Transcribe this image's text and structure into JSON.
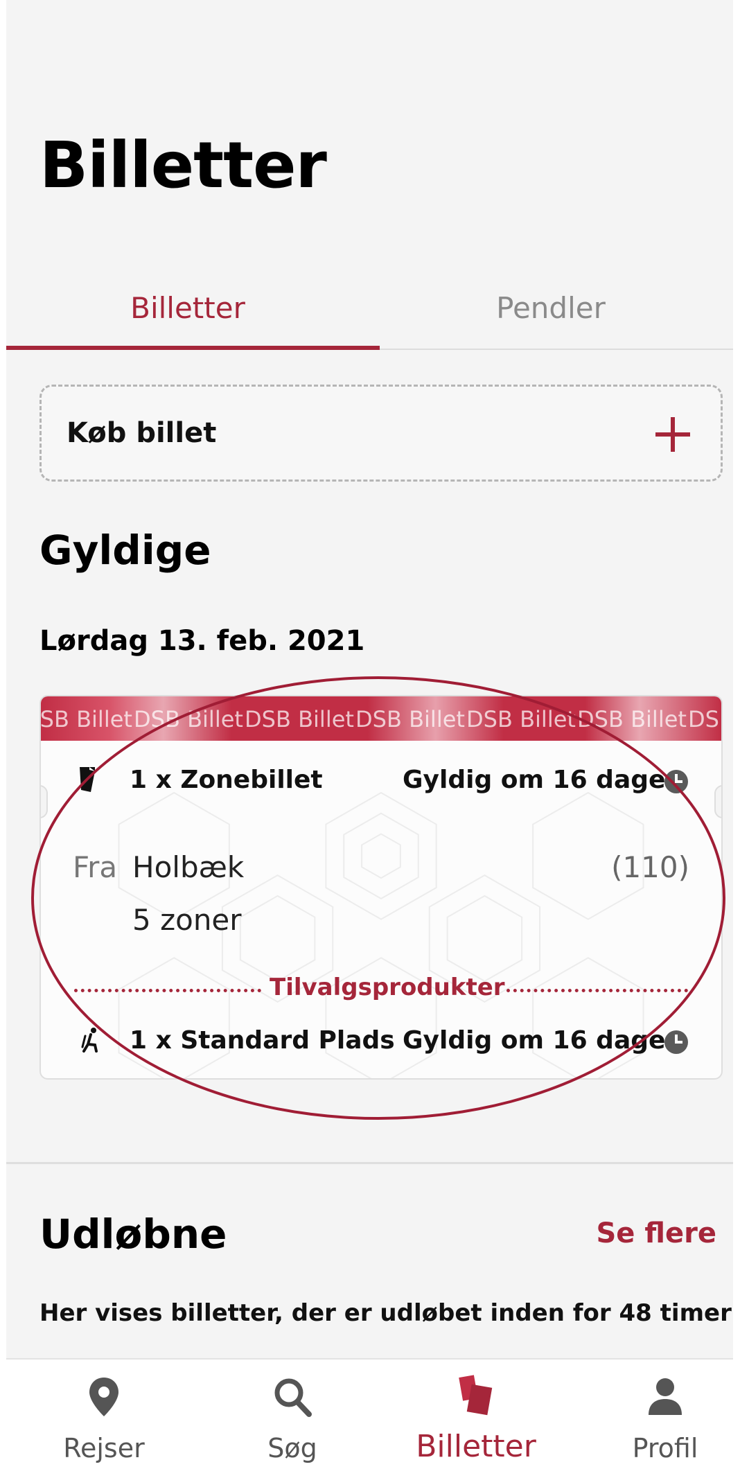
{
  "page": {
    "title": "Billetter"
  },
  "tabs": [
    {
      "label": "Billetter",
      "selected": true
    },
    {
      "label": "Pendler",
      "selected": false
    }
  ],
  "buy": {
    "label": "Køb billet",
    "icon": "plus-icon"
  },
  "valid": {
    "title": "Gyldige",
    "date": "Lørdag 13. feb. 2021",
    "ticket": {
      "banner_text": "DSB Billet",
      "main": {
        "title": "1 x Zonebillet",
        "validity": "Gyldig om 16 dage",
        "icon": "ticket-icon"
      },
      "from_label": "Fra",
      "station": "Holbæk",
      "station_code": "(110)",
      "zones": "5 zoner",
      "addons_label": "Tilvalgsprodukter",
      "addon": {
        "title": "1 x Standard Plads",
        "validity": "Gyldig om 16 dage",
        "icon": "seat-icon"
      }
    }
  },
  "expired": {
    "title": "Udløbne",
    "see_more": "Se flere",
    "description": "Her vises billetter, der er udløbet inden for 48 timer"
  },
  "bottom_nav": [
    {
      "label": "Rejser",
      "icon": "location-pin-icon",
      "active": false
    },
    {
      "label": "Søg",
      "icon": "search-icon",
      "active": false
    },
    {
      "label": "Billetter",
      "icon": "tickets-icon",
      "active": true
    },
    {
      "label": "Profil",
      "icon": "profile-icon",
      "active": false
    }
  ],
  "colors": {
    "accent": "#a5263a",
    "background": "#f4f4f4",
    "annotation": "#a01d35"
  }
}
